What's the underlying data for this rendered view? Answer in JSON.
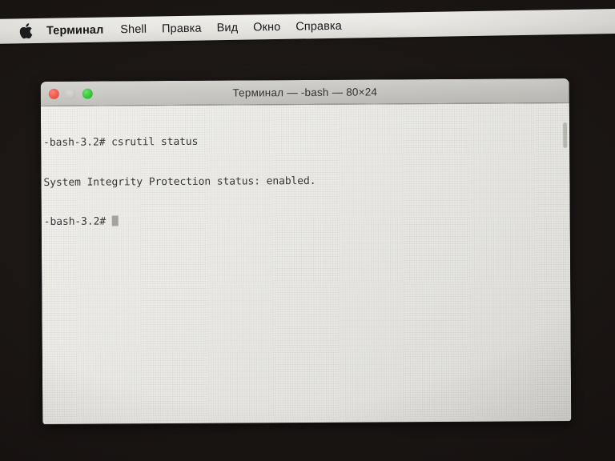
{
  "desktop": {
    "background_color": "#171210"
  },
  "menubar": {
    "apple_icon": "apple-logo-icon",
    "items": [
      {
        "label": "Терминал",
        "bold": true
      },
      {
        "label": "Shell",
        "bold": false
      },
      {
        "label": "Правка",
        "bold": false
      },
      {
        "label": "Вид",
        "bold": false
      },
      {
        "label": "Окно",
        "bold": false
      },
      {
        "label": "Справка",
        "bold": false
      }
    ]
  },
  "window": {
    "title": "Терминал — -bash — 80×24",
    "traffic_lights": [
      {
        "name": "close",
        "color": "#ee4f3f"
      },
      {
        "name": "minimize",
        "color": "#c4c3be"
      },
      {
        "name": "zoom",
        "color": "#27c32c"
      }
    ],
    "terminal": {
      "background_color": "#f2f1ec",
      "text_color": "#2c2c2c",
      "cursor_color": "#a6a49f",
      "lines": [
        "-bash-3.2# csrutil status",
        "System Integrity Protection status: enabled.",
        "-bash-3.2# "
      ]
    }
  }
}
